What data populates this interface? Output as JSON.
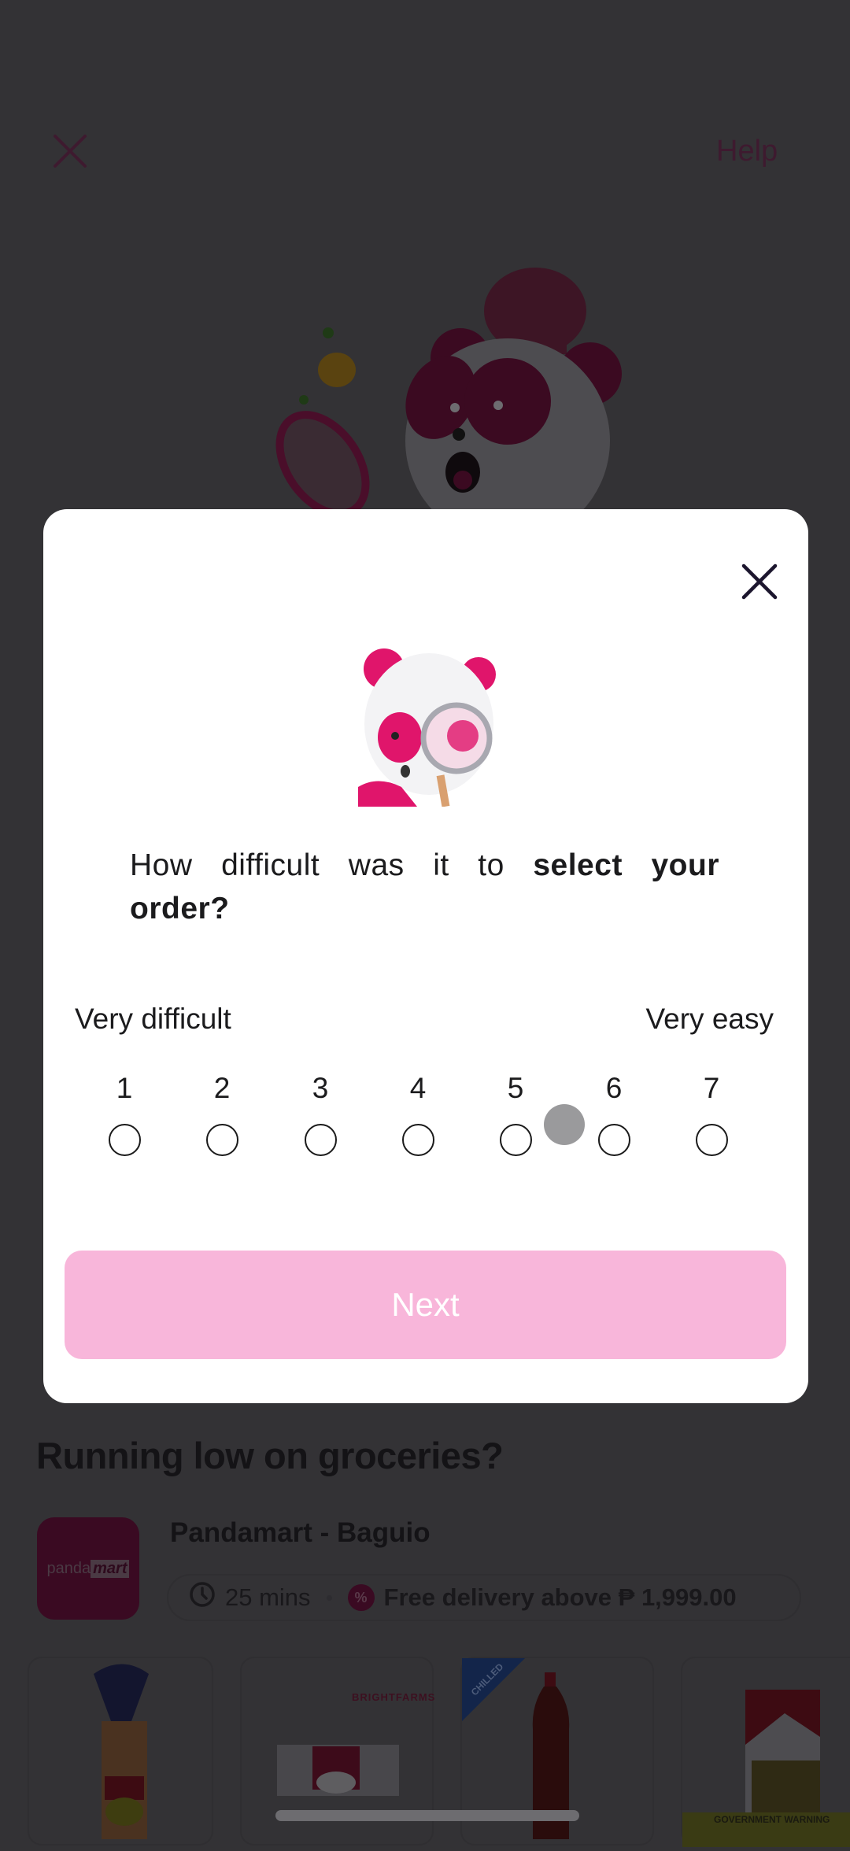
{
  "background": {
    "header": {
      "close_icon": "close-icon",
      "help_label": "Help"
    },
    "mascot": "chef-panda-with-frying-pan",
    "section_title": "Running low on groceries?",
    "store": {
      "logo_text_1": "panda",
      "logo_text_2": "mart",
      "name": "Pandamart - Baguio",
      "delivery_time_icon": "clock-icon",
      "delivery_time": "25 mins",
      "promo_icon": "discount-badge-icon",
      "promo_text": "Free delivery above ₱ 1,999.00"
    },
    "products": [
      {
        "name": "Sliced bread loaf"
      },
      {
        "name": "Bright Farms eggs",
        "brand_label": "BRIGHTFARMS"
      },
      {
        "name": "Coca-Cola bottle",
        "badge": "CHILLED"
      },
      {
        "name": "Cigarette pack",
        "warning": "GOVERNMENT WARNING"
      }
    ]
  },
  "survey_modal": {
    "close_icon": "close-icon",
    "mascot": "panda-with-magnifying-glass",
    "question_prefix": "How difficult was it to ",
    "question_emphasis": "select your order?",
    "scale": {
      "min_label": "Very difficult",
      "max_label": "Very easy",
      "options": [
        "1",
        "2",
        "3",
        "4",
        "5",
        "6",
        "7"
      ],
      "selected": null
    },
    "next_label": "Next",
    "next_enabled": false
  },
  "colors": {
    "brand_pink": "#d70f64",
    "next_disabled": "#f8b6da",
    "overlay": "#333235"
  }
}
